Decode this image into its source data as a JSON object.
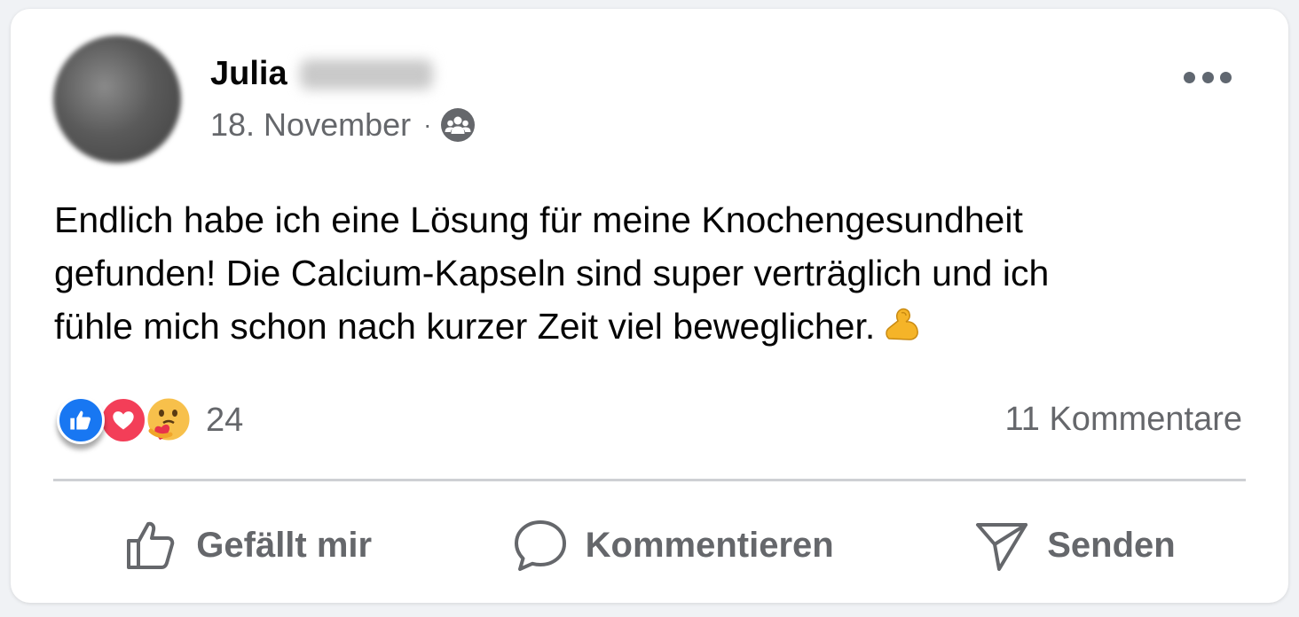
{
  "post": {
    "author_first_name": "Julia",
    "date": "18. November",
    "separator": "·",
    "audience_icon": "group-audience-icon",
    "text_lines": [
      "Endlich habe ich eine Lösung für meine Knochengesundheit",
      "gefunden! Die Calcium-Kapseln sind super verträglich und ich",
      "fühle mich schon nach kurzer Zeit viel beweglicher."
    ],
    "text_emoji": "flexed-biceps-icon"
  },
  "reactions": {
    "types": [
      "like-reaction-icon",
      "love-reaction-icon",
      "care-reaction-icon"
    ],
    "count": "24"
  },
  "comments": {
    "count_label": "11 Kommentare"
  },
  "actions": {
    "like_label": "Gefällt mir",
    "comment_label": "Kommentieren",
    "share_label": "Senden"
  },
  "colors": {
    "like_blue": "#1877f2",
    "love_red": "#f33e58",
    "secondary_text": "#65676b",
    "primary_text": "#050505"
  }
}
